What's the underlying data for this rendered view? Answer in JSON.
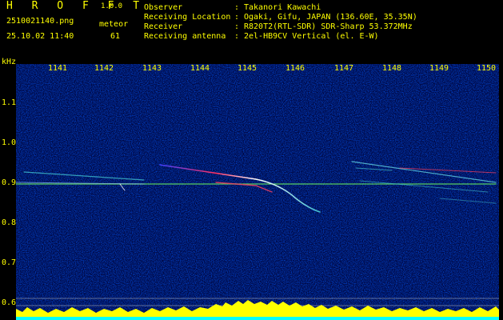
{
  "header": {
    "app_title": "H R O F F T",
    "app_version": "1.0.0",
    "file_name": "2510021140.png",
    "timestamp": "25.10.02 11:40",
    "meteor_label": "meteor",
    "meteor_count": "61",
    "info": [
      {
        "key": "Observer",
        "value": "Takanori Kawachi"
      },
      {
        "key": "Receiving Location",
        "value": "Ogaki, Gifu, JAPAN (136.60E, 35.35N)"
      },
      {
        "key": "Receiver",
        "value": "R820T2(RTL-SDR) SDR-Sharp 53.372MHz"
      },
      {
        "key": "Receiving antenna",
        "value": "2el-HB9CV Vertical (el. E-W)"
      }
    ]
  },
  "spectrogram": {
    "y_unit": "kHz",
    "y_ticks": [
      "1.1",
      "1.0",
      "0.9",
      "0.8",
      "0.7",
      "0.6"
    ],
    "x_ticks": [
      "1141",
      "1142",
      "1143",
      "1144",
      "1145",
      "1146",
      "1147",
      "1148",
      "1149",
      "1150"
    ],
    "colors": {
      "background": "#00084a",
      "label": "#ffff00",
      "carrier": "#60e060",
      "meteor": "#40c0d0",
      "meteor_head": "#ff3040",
      "signal_meter": "#ffff00",
      "baseline": "#00ffff"
    }
  }
}
